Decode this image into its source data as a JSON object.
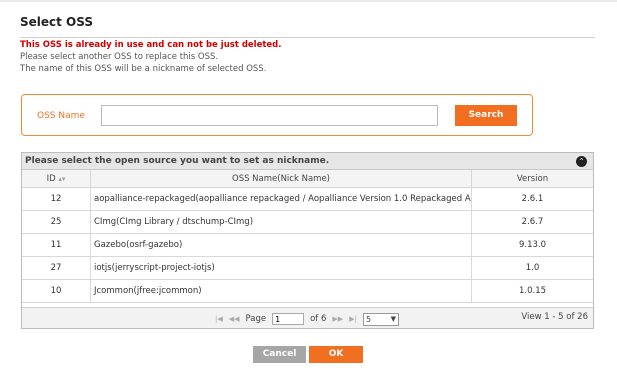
{
  "dialog": {
    "title": "Select OSS",
    "warning": "This OSS is already in use and can not be just deleted.",
    "note_1": "Please select another OSS to replace this OSS.",
    "note_2": "The name of this OSS will be a nickname of selected OSS."
  },
  "search": {
    "label": "OSS Name",
    "value": "",
    "placeholder": "",
    "button_label": "Search"
  },
  "grid": {
    "caption": "Please select the open source you want to set as nickname.",
    "columns": {
      "id": "ID",
      "name": "OSS Name(Nick Name)",
      "version": "Version"
    },
    "rows": [
      {
        "id": "12",
        "name": "aopalliance-repackaged(aopalliance repackaged / Aopalliance Version 1.0 Repackaged As A Module)",
        "version": "2.6.1"
      },
      {
        "id": "25",
        "name": "CImg(CImg Library / dtschump-CImg)",
        "version": "2.6.7"
      },
      {
        "id": "11",
        "name": "Gazebo(osrf-gazebo)",
        "version": "9.13.0"
      },
      {
        "id": "27",
        "name": "iotjs(jerryscript-project-iotjs)",
        "version": "1.0"
      },
      {
        "id": "10",
        "name": "Jcommon(jfree:jcommon)",
        "version": "1.0.15"
      }
    ],
    "pager": {
      "page_label": "Page",
      "page_value": "1",
      "of_label": "of 6",
      "rows_per_page": "5",
      "info": "View 1 - 5 of 26"
    }
  },
  "actions": {
    "cancel_label": "Cancel",
    "ok_label": "OK"
  },
  "colors": {
    "accent": "#f26f21",
    "warning": "#d40000"
  }
}
